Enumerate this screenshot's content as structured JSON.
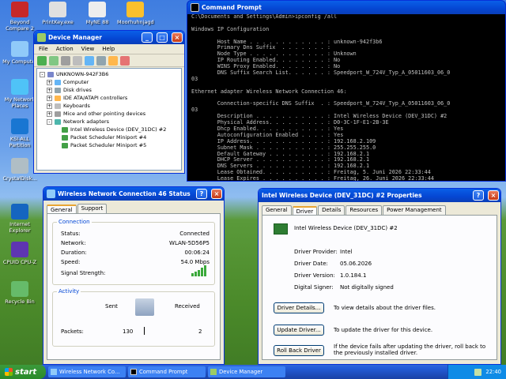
{
  "desktop": {
    "icons": [
      {
        "label": "Beyond Compare 2",
        "color": "#c62828"
      },
      {
        "label": "PrintKey.exe",
        "color": "#e0e0e0"
      },
      {
        "label": "MyNE 88",
        "color": "#eeeeee"
      },
      {
        "label": "Moorhuhnjagd",
        "color": "#fbc02d"
      },
      {
        "label": "My Computer",
        "color": "#90caf9"
      },
      {
        "label": "My Network Places",
        "color": "#4fc3f7"
      },
      {
        "label": "KSI-ALL Partition",
        "color": "#1976d2"
      },
      {
        "label": "CrystalDisk...",
        "color": "#b0bec5"
      },
      {
        "label": "Internet Explorer",
        "color": "#1565c0"
      },
      {
        "label": "CPUID CPU-Z",
        "color": "#5e35b1"
      },
      {
        "label": "Recycle Bin",
        "color": "#66bb6a"
      }
    ]
  },
  "device_manager": {
    "title": "Device Manager",
    "menu": [
      "File",
      "Action",
      "View",
      "Help"
    ],
    "tree": [
      {
        "label": "UNKNOWN-942F3B6",
        "level": 0,
        "expander": "-"
      },
      {
        "label": "Computer",
        "level": 1,
        "expander": "+"
      },
      {
        "label": "Disk drives",
        "level": 1,
        "expander": "+"
      },
      {
        "label": "IDE ATA/ATAPI controllers",
        "level": 1,
        "expander": "+"
      },
      {
        "label": "Keyboards",
        "level": 1,
        "expander": "+"
      },
      {
        "label": "Mice and other pointing devices",
        "level": 1,
        "expander": "+"
      },
      {
        "label": "Network adapters",
        "level": 1,
        "expander": "-"
      },
      {
        "label": "Intel Wireless Device (DEV_31DC) #2",
        "level": 2,
        "expander": ""
      },
      {
        "label": "Packet Scheduler Miniport #4",
        "level": 2,
        "expander": ""
      },
      {
        "label": "Packet Scheduler Miniport #5",
        "level": 2,
        "expander": ""
      }
    ]
  },
  "cmd": {
    "title": "Command Prompt",
    "lines": [
      "C:\\Documents and Settings\\Admin>ipconfig /all",
      "",
      "Windows IP Configuration",
      "",
      "        Host Name . . . . . . . . . . . . : unknown-942f3b6",
      "        Primary Dns Suffix  . . . . . . . :",
      "        Node Type . . . . . . . . . . . . : Unknown",
      "        IP Routing Enabled. . . . . . . . : No",
      "        WINS Proxy Enabled. . . . . . . . : No",
      "        DNS Suffix Search List. . . . . . : Speedport_W_724V_Typ_A_05011603_06_0",
      "03",
      "",
      "Ethernet adapter Wireless Network Connection 46:",
      "",
      "        Connection-specific DNS Suffix  . : Speedport_W_724V_Typ_A_05011603_06_0",
      "03",
      "        Description . . . . . . . . . . . : Intel Wireless Device (DEV_31DC) #2",
      "        Physical Address. . . . . . . . . : D0-3C-1F-E1-2B-3E",
      "        Dhcp Enabled. . . . . . . . . . . : Yes",
      "        Autoconfiguration Enabled . . . . : Yes",
      "        IP Address. . . . . . . . . . . . : 192.168.2.109",
      "        Subnet Mask . . . . . . . . . . . : 255.255.255.0",
      "        Default Gateway . . . . . . . . . : 192.168.2.1",
      "        DHCP Server . . . . . . . . . . . : 192.168.2.1",
      "        DNS Servers . . . . . . . . . . . : 192.168.2.1",
      "        Lease Obtained. . . . . . . . . . : Freitag, 5. Juni 2026 22:33:44",
      "        Lease Expires . . . . . . . . . . : Freitag, 26. Juni 2026 22:33:44"
    ]
  },
  "status": {
    "title": "Wireless Network Connection 46 Status",
    "tabs": [
      "General",
      "Support"
    ],
    "connection_label": "Connection",
    "fields": [
      {
        "label": "Status:",
        "value": "Connected"
      },
      {
        "label": "Network:",
        "value": "WLAN-5D56P5"
      },
      {
        "label": "Duration:",
        "value": "00:06:24"
      },
      {
        "label": "Speed:",
        "value": "54.0 Mbps"
      }
    ],
    "signal_label": "Signal Strength:",
    "activity_label": "Activity",
    "sent_label": "Sent",
    "received_label": "Received",
    "packets_label": "Packets:",
    "packets_sent": "130",
    "packets_received": "2"
  },
  "props": {
    "title": "Intel Wireless Device (DEV_31DC) #2 Properties",
    "tabs": [
      "General",
      "Driver",
      "Details",
      "Resources",
      "Power Management"
    ],
    "device_name": "Intel Wireless Device (DEV_31DC) #2",
    "fields": [
      {
        "label": "Driver Provider:",
        "value": "Intel"
      },
      {
        "label": "Driver Date:",
        "value": "05.06.2026"
      },
      {
        "label": "Driver Version:",
        "value": "1.0.184.1"
      },
      {
        "label": "Digital Signer:",
        "value": "Not digitally signed"
      }
    ],
    "buttons": [
      {
        "label": "Driver Details...",
        "desc": "To view details about the driver files."
      },
      {
        "label": "Update Driver...",
        "desc": "To update the driver for this device."
      },
      {
        "label": "Roll Back Driver",
        "desc": "If the device fails after updating the driver, roll back to the previously installed driver."
      }
    ]
  },
  "taskbar": {
    "start": "start",
    "buttons": [
      "Wireless Network Co...",
      "Command Prompt",
      "Device Manager"
    ],
    "clock": "22:40"
  },
  "colors": {
    "accent": "#0a5fe8",
    "start": "#2a8a2a"
  }
}
